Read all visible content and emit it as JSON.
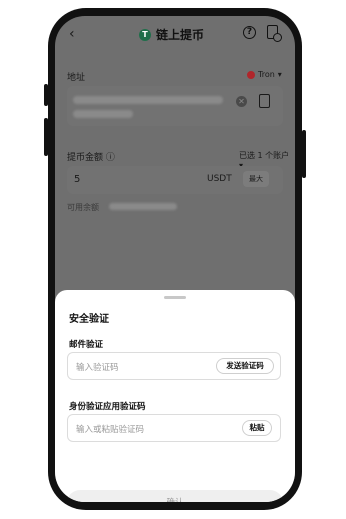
{
  "header": {
    "back_glyph": "‹",
    "title": "链上提币",
    "coin_badge": "T"
  },
  "address": {
    "label": "地址",
    "network": "Tron"
  },
  "amount": {
    "label": "提币金额",
    "info_glyph": "ⓘ",
    "account_select": "已选 1 个账户",
    "value": "5",
    "currency": "USDT",
    "max_label": "最大",
    "available_label": "可用余额"
  },
  "verification": {
    "title": "安全验证",
    "email_label": "邮件验证",
    "email_placeholder": "输入验证码",
    "send_code_label": "发送验证码",
    "authenticator_label": "身份验证应用验证码",
    "authenticator_placeholder": "输入或粘贴验证码",
    "paste_label": "粘贴",
    "confirm_label": "确认"
  },
  "colors": {
    "overlay": "#6f6f6f",
    "sheet": "#ffffff",
    "tron_red": "#b0262b",
    "badge_green": "#1f6e4a"
  }
}
